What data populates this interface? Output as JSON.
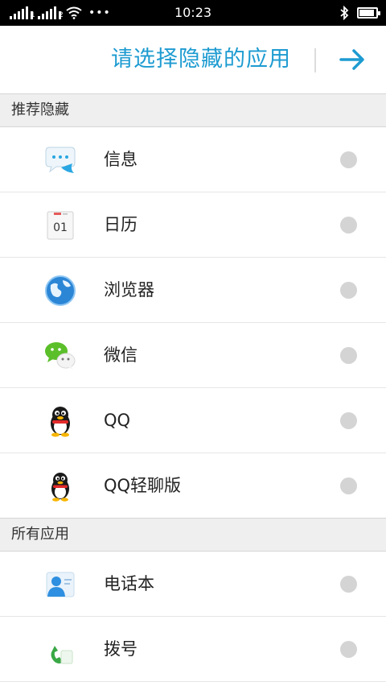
{
  "status_bar": {
    "signal1_label": "1",
    "signal2_label": "2",
    "time": "10:23",
    "battery_level": 0.9
  },
  "header": {
    "title": "请选择隐藏的应用"
  },
  "sections": {
    "recommended": "推荐隐藏",
    "all": "所有应用"
  },
  "apps": [
    {
      "label": "信息",
      "icon": "message-icon"
    },
    {
      "label": "日历",
      "icon": "calendar-icon",
      "icon_text": "01"
    },
    {
      "label": "浏览器",
      "icon": "browser-globe-icon"
    },
    {
      "label": "微信",
      "icon": "wechat-icon"
    },
    {
      "label": "QQ",
      "icon": "qq-penguin-icon"
    },
    {
      "label": "QQ轻聊版",
      "icon": "qq-lite-penguin-icon"
    },
    {
      "label": "电话本",
      "icon": "contacts-icon"
    },
    {
      "label": "拨号",
      "icon": "phone-dialer-icon"
    }
  ],
  "colors": {
    "accent": "#1d9bd1",
    "section_bg": "#efefef",
    "radio_off": "#d4d4d4"
  }
}
